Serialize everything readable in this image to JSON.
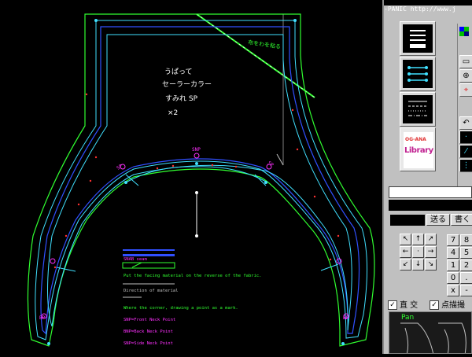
{
  "app": {
    "title": "-PANIC  http://www.j",
    "window_tab": "Pan"
  },
  "canvas": {
    "label_jp_1": "うぱって",
    "label_jp_2": "セーラーカラー",
    "label_jp_3": "すみれ SP",
    "label_jp_4": "×2",
    "fold_label": "布をわを粘る",
    "marker_snp": "SNP",
    "marker_sp_left": "SP",
    "marker_sp_right": "SP",
    "marker_bp_left": "BP",
    "marker_bp_right": "BP",
    "legend": {
      "item1": "SNAB seam",
      "item2": "Put the facing material on the reverse of the fabric.",
      "item3": "Direction of material",
      "item4": "Where the corner, drawing a point as a mark.",
      "item5": "SNP=Front Neck Point",
      "item6": "BNP=Back Neck Point",
      "item7": "SNP=Side Neck Point"
    }
  },
  "panel": {
    "library_logo_top": "OG-ANA",
    "library_logo_text": "Library",
    "send_button": "送る",
    "write_button": "書く",
    "keypad": [
      "7",
      "8",
      "4",
      "5",
      "1",
      "2",
      "0",
      ".",
      "x",
      "-"
    ],
    "check_right_angle": "直 交",
    "check_point_draw": "点描撮"
  },
  "colors": {
    "canvas_bg": "#000000",
    "outer_line": "#30ff30",
    "cyan_line": "#40e0ff",
    "blue_line": "#3050ff",
    "magenta": "#ff30ff",
    "panel_bg": "#c0c0c0"
  }
}
